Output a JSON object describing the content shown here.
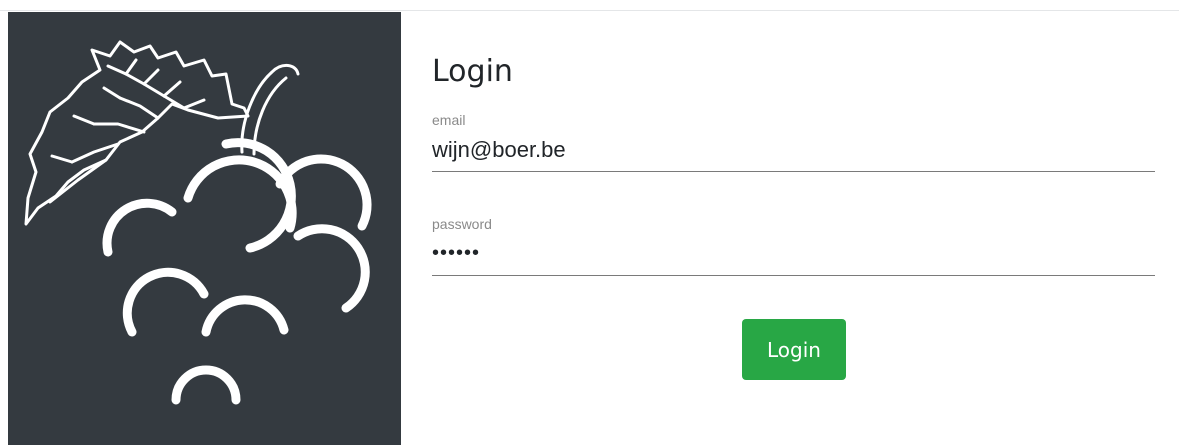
{
  "logo": {
    "icon": "grape-vine-icon"
  },
  "form": {
    "title": "Login",
    "email": {
      "label": "email",
      "value": "wijn@boer.be"
    },
    "password": {
      "label": "password",
      "value": "secret"
    },
    "submit_label": "Login"
  },
  "colors": {
    "hero_background": "#343a40",
    "button_background": "#28a745",
    "button_text": "#ffffff"
  }
}
